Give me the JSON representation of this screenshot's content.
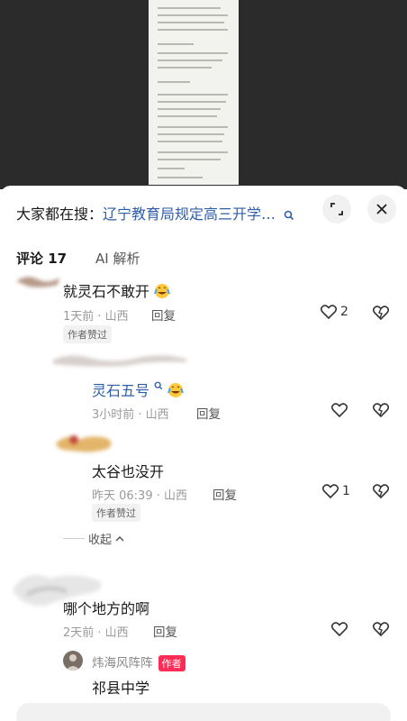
{
  "background": {
    "doc_color": "#f2f2ee",
    "dim_color": "#2b2b2b"
  },
  "header": {
    "search_prefix": "大家都在搜：",
    "search_term": "辽宁教育局规定高三开学…",
    "expand_icon": "expand-icon",
    "close_icon": "close-icon"
  },
  "tabs": [
    {
      "label": "评论 17",
      "active": true
    },
    {
      "label": "AI 解析",
      "active": false
    }
  ],
  "comments": [
    {
      "text": "就灵石不敢开",
      "emoji": "laugh-cry-emoji",
      "meta": "1天前 · 山西",
      "reply": "回复",
      "likes": "2",
      "badge": "作者赞过"
    },
    {
      "text": "灵石五号",
      "emoji": "laugh-cry-emoji",
      "meta": "3小时前 · 山西",
      "reply": "回复",
      "likes": ""
    },
    {
      "text": "太谷也没开",
      "meta": "昨天 06:39 · 山西",
      "reply": "回复",
      "likes": "1",
      "badge": "作者赞过"
    },
    {
      "collapse_label": "收起"
    },
    {
      "text": "哪个地方的啊",
      "meta": "2天前 · 山西",
      "reply": "回复",
      "likes": ""
    },
    {
      "author_name": "炜海风阵阵",
      "author_tag": "作者",
      "text": "祁县中学"
    }
  ],
  "colors": {
    "link": "#2f5ea8",
    "author_tag": "#ff2d55"
  }
}
